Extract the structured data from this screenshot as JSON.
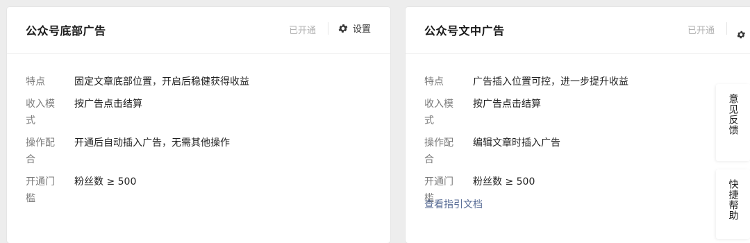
{
  "cards": [
    {
      "title": "公众号底部广告",
      "status": "已开通",
      "settings_label": "设置",
      "rows": [
        {
          "label": "特点",
          "value": "固定文章底部位置，开启后稳健获得收益"
        },
        {
          "label": "收入模式",
          "value": "按广告点击结算"
        },
        {
          "label": "操作配合",
          "value": "开通后自动插入广告，无需其他操作"
        },
        {
          "label": "开通门槛",
          "value": "粉丝数 ≥ 500"
        }
      ]
    },
    {
      "title": "公众号文中广告",
      "status": "已开通",
      "settings_label": "设置",
      "rows": [
        {
          "label": "特点",
          "value": "广告插入位置可控，进一步提升收益"
        },
        {
          "label": "收入模式",
          "value": "按广告点击结算"
        },
        {
          "label": "操作配合",
          "value": "编辑文章时插入广告"
        },
        {
          "label": "开通门槛",
          "value": "粉丝数 ≥ 500"
        }
      ],
      "doc_link": "查看指引文档"
    }
  ],
  "floating": {
    "feedback": "意见反馈",
    "help": "快捷帮助"
  },
  "colors": {
    "link": "#576b95",
    "muted": "#b2b2b2",
    "label": "#7b7b7b"
  }
}
